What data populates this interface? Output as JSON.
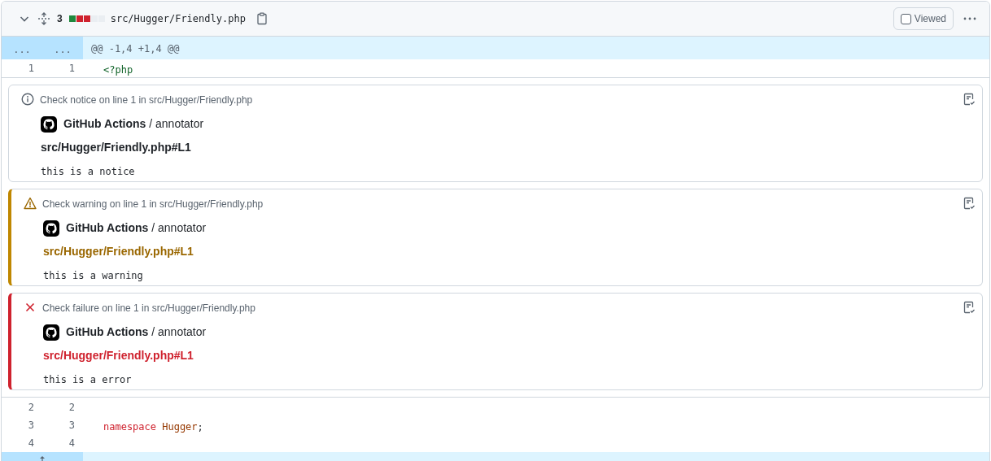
{
  "file": {
    "expanded": true,
    "changes": "3",
    "diffstat": [
      {
        "color": "#1f883d"
      },
      {
        "color": "#cf222e"
      },
      {
        "color": "#cf222e"
      },
      {
        "color": "#eaeef2"
      },
      {
        "color": "#eaeef2"
      }
    ],
    "path": "src/Hugger/Friendly.php",
    "viewed": false,
    "viewed_label": "Viewed"
  },
  "hunk": {
    "old": "...",
    "new": "...",
    "header": "@@ -1,4 +1,4 @@"
  },
  "lines_before": [
    {
      "old": "1",
      "new": "1",
      "tokens": [
        {
          "kind": "tag",
          "text": "<?php"
        }
      ]
    }
  ],
  "annotations": [
    {
      "kind": "notice",
      "title": "Check notice on line 1 in src/Hugger/Friendly.php",
      "app": "GitHub Actions",
      "job": "/ annotator",
      "location": "src/Hugger/Friendly.php#L1",
      "message": "this is a notice"
    },
    {
      "kind": "warning",
      "title": "Check warning on line 1 in src/Hugger/Friendly.php",
      "app": "GitHub Actions",
      "job": "/ annotator",
      "location": "src/Hugger/Friendly.php#L1",
      "message": "this is a warning"
    },
    {
      "kind": "failure",
      "title": "Check failure on line 1 in src/Hugger/Friendly.php",
      "app": "GitHub Actions",
      "job": "/ annotator",
      "location": "src/Hugger/Friendly.php#L1",
      "message": "this is a error"
    }
  ],
  "lines_after": [
    {
      "old": "2",
      "new": "2"
    },
    {
      "old": "3",
      "new": "3",
      "tokens": [
        {
          "kind": "keyword",
          "text": "namespace"
        },
        {
          "kind": "name",
          "text": "Hugger"
        },
        {
          "kind": "plain",
          "text": ";"
        }
      ]
    },
    {
      "old": "4",
      "new": "4"
    }
  ]
}
